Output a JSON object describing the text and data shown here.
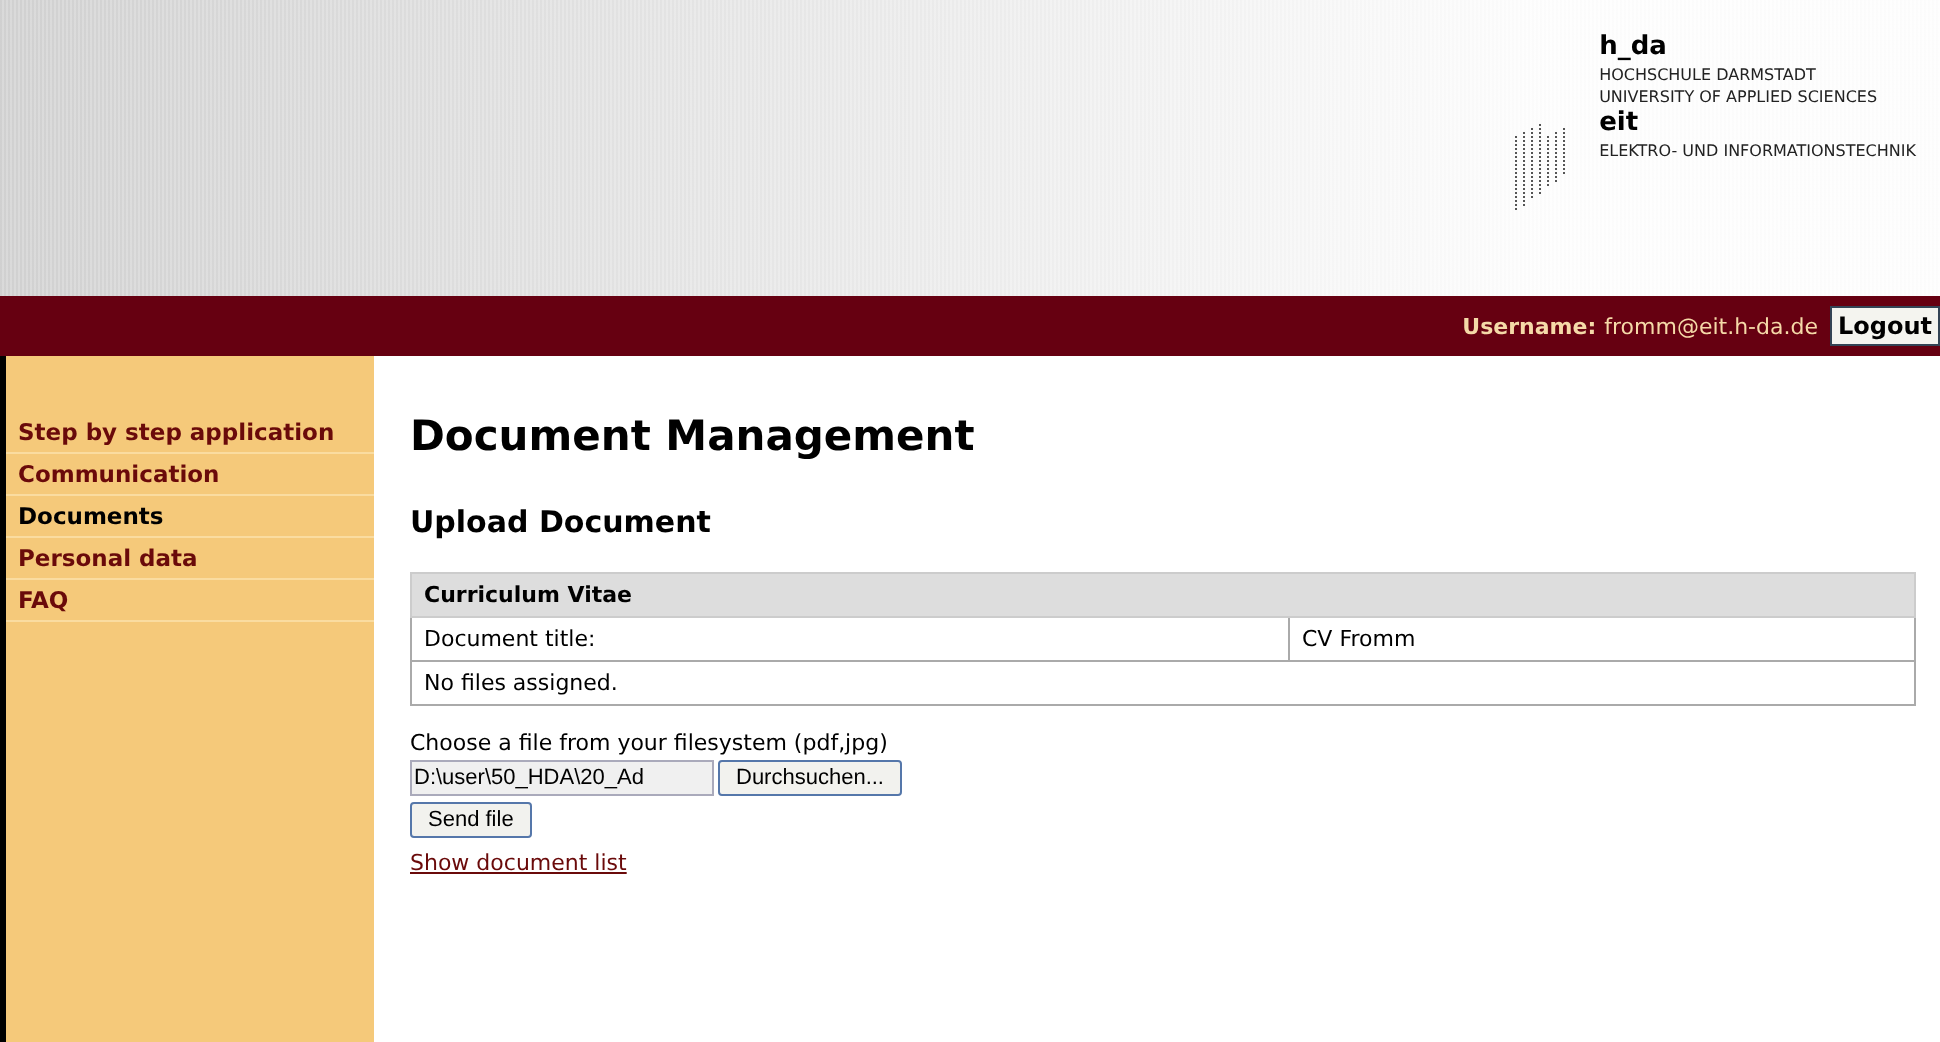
{
  "logo": {
    "name": "h_da",
    "lines": [
      "HOCHSCHULE DARMSTADT",
      "UNIVERSITY OF APPLIED SCIENCES"
    ],
    "department": "eit",
    "department_line": "ELEKTRO- UND INFORMATIONSTECHNIK"
  },
  "user_bar": {
    "label": "Username:",
    "user": "fromm@eit.h-da.de",
    "logout": "Logout"
  },
  "sidebar": {
    "items": [
      {
        "label": "Step by step application",
        "selected": false
      },
      {
        "label": "Communication",
        "selected": false
      },
      {
        "label": "Documents",
        "selected": true
      },
      {
        "label": "Personal data",
        "selected": false
      },
      {
        "label": "FAQ",
        "selected": false
      }
    ]
  },
  "title": "Document Management",
  "subtitle": "Upload Document",
  "table": {
    "heading": "Curriculum Vitae",
    "title_label": "Document title:",
    "title_value": "CV Fromm",
    "files": "No files assigned."
  },
  "upload": {
    "prompt": "Choose a file from your filesystem (pdf,jpg)",
    "value": "D:\\user\\50_HDA\\20_Ad",
    "browse": "Durchsuchen...",
    "send": "Send file"
  },
  "link": "Show document list"
}
